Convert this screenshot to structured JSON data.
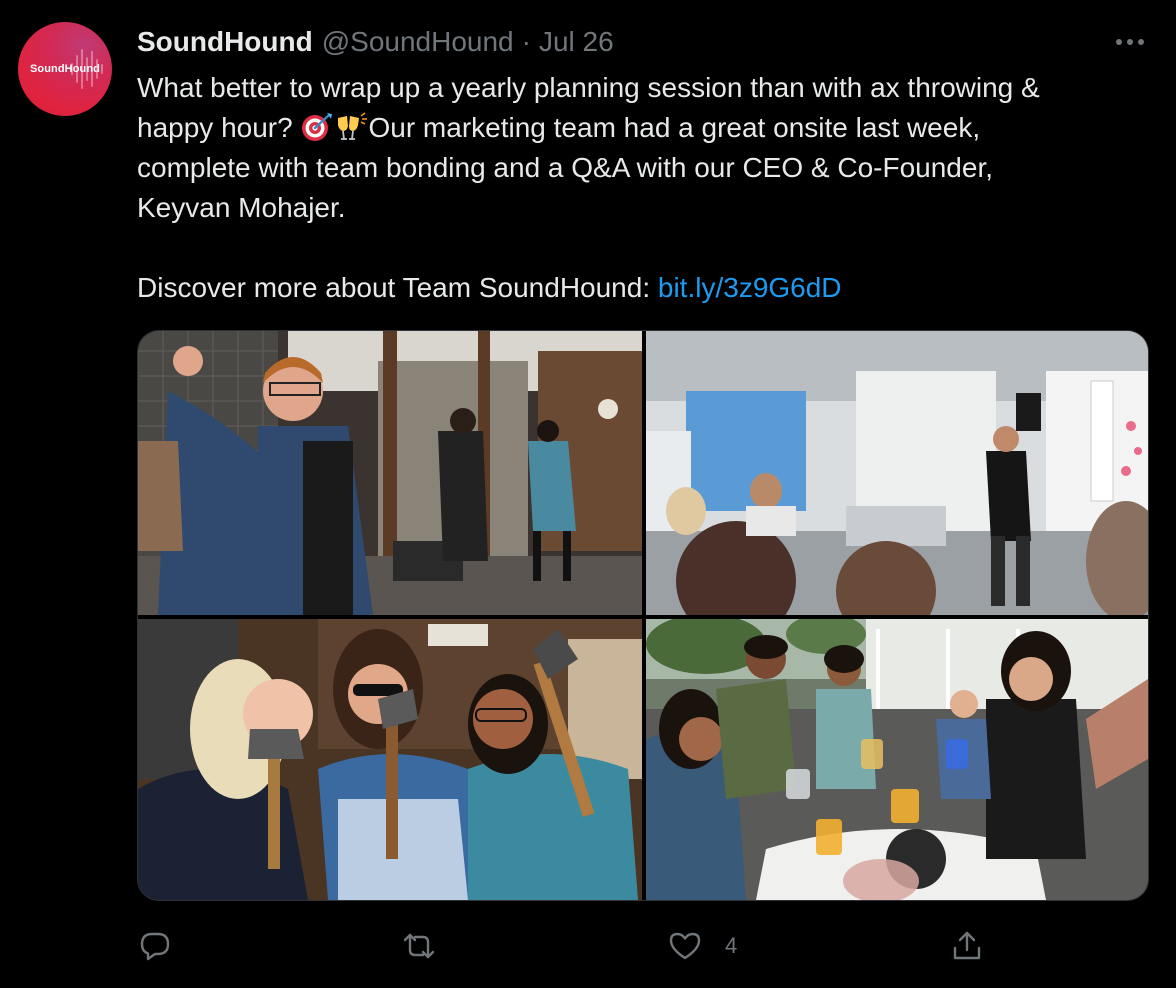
{
  "tweet": {
    "avatar_text": "SoundHound",
    "display_name": "SoundHound",
    "handle": "@SoundHound",
    "separator": "·",
    "date": "Jul 26",
    "text_line_1": "What better to wrap up a yearly planning session than with ax throwing &",
    "text_line_2a": "happy hour? ",
    "text_line_2b": "Our marketing team had a great onsite last week,",
    "text_line_3": "complete with team bonding and a Q&A with our CEO & Co-Founder,",
    "text_line_4": "Keyvan Mohajer.",
    "discover_text": "Discover more about Team SoundHound: ",
    "link_text": "bit.ly/3z9G6dD",
    "emojis": [
      "direct-hit-icon",
      "clinking-glasses-icon"
    ]
  },
  "media": {
    "photos": [
      {
        "name": "ax-throwing-photo"
      },
      {
        "name": "ceo-qa-photo"
      },
      {
        "name": "team-with-axes-photo"
      },
      {
        "name": "happy-hour-toast-photo"
      }
    ]
  },
  "actions": {
    "reply_icon": "reply-icon",
    "retweet_icon": "retweet-icon",
    "like_icon": "heart-icon",
    "like_count": "4",
    "share_icon": "share-icon"
  },
  "colors": {
    "background": "#000000",
    "text": "#e7e9ea",
    "muted": "#71767b",
    "link": "#1d9bf0",
    "brand": "#e0233f"
  }
}
